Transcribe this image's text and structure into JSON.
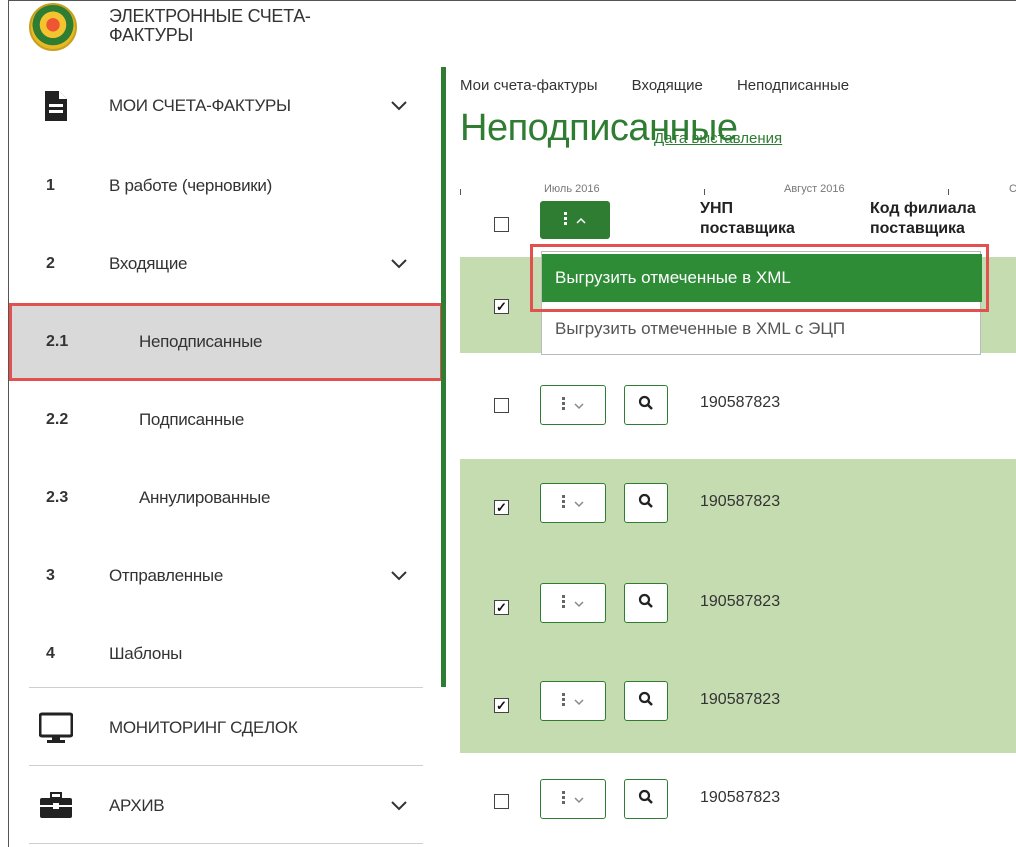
{
  "app": {
    "title": "ЭЛЕКТРОННЫЕ СЧЕТА-ФАКТУРЫ"
  },
  "sidebar": {
    "items": [
      {
        "num": "",
        "label": "МОИ СЧЕТА-ФАКТУРЫ",
        "icon": "document-icon",
        "expanded": true
      },
      {
        "num": "1",
        "label": "В работе (черновики)"
      },
      {
        "num": "2",
        "label": "Входящие",
        "expanded": true
      },
      {
        "num": "2.1",
        "label": "Неподписанные",
        "active": true
      },
      {
        "num": "2.2",
        "label": "Подписанные"
      },
      {
        "num": "2.3",
        "label": "Аннулированные"
      },
      {
        "num": "3",
        "label": "Отправленные",
        "expanded": true
      },
      {
        "num": "4",
        "label": "Шаблоны"
      },
      {
        "num": "",
        "label": "МОНИТОРИНГ СДЕЛОК",
        "icon": "monitor-icon"
      },
      {
        "num": "",
        "label": "АРХИВ",
        "icon": "briefcase-icon",
        "expanded": true
      }
    ]
  },
  "main": {
    "breadcrumbs": [
      "Мои счета-фактуры",
      "Входящие",
      "Неподписанные"
    ],
    "title": "Неподписанные",
    "date_link": "Дата выставления",
    "timeline": {
      "labels": [
        "Июль 2016",
        "Август 2016",
        "С"
      ]
    },
    "table": {
      "headers": {
        "unp": "УНП поставщика",
        "branch": "Код филиала поставщика"
      },
      "rows": [
        {
          "checked": true,
          "unp": ""
        },
        {
          "checked": false,
          "unp": "190587823"
        },
        {
          "checked": true,
          "unp": "190587823"
        },
        {
          "checked": true,
          "unp": "190587823"
        },
        {
          "checked": true,
          "unp": "190587823"
        },
        {
          "checked": false,
          "unp": "190587823"
        }
      ]
    },
    "dropdown": {
      "items": [
        "Выгрузить отмеченные в XML",
        "Выгрузить отмеченные в XML с ЭЦП"
      ]
    }
  },
  "colors": {
    "accent": "#2e7d32",
    "selected_row": "#c5dbb0",
    "highlight": "#e0514f"
  }
}
